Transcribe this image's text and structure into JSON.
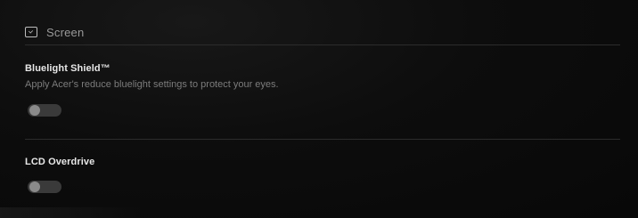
{
  "section": {
    "icon": "screen-icon",
    "title": "Screen"
  },
  "settings": [
    {
      "title": "Bluelight Shield™",
      "description": "Apply Acer's reduce bluelight settings to protect your eyes.",
      "toggle_state": "off"
    },
    {
      "title": "LCD Overdrive",
      "toggle_state": "off"
    }
  ],
  "colors": {
    "background": "#0a0a0a",
    "title_text": "#e8e8e8",
    "secondary_text": "#7c7c7c",
    "toggle_off": "#3a3a3a"
  }
}
